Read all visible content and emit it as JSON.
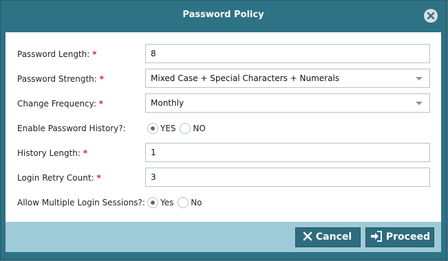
{
  "dialog": {
    "title": "Password Policy",
    "close_icon": "close-circle-icon"
  },
  "form": {
    "password_length": {
      "label": "Password Length:",
      "required": "*",
      "value": "8"
    },
    "password_strength": {
      "label": "Password Strength:",
      "required": "*",
      "value": "Mixed Case + Special Characters + Numerals"
    },
    "change_frequency": {
      "label": "Change Frequency:",
      "required": "*",
      "value": "Monthly"
    },
    "enable_history": {
      "label": "Enable Password History?:",
      "option_yes": "YES",
      "option_no": "NO",
      "selected": "YES"
    },
    "history_length": {
      "label": "History Length:",
      "required": "*",
      "value": "1"
    },
    "login_retry": {
      "label": "Login Retry Count:",
      "required": "*",
      "value": "3"
    },
    "multiple_sessions": {
      "label": "Allow Multiple Login Sessions?:",
      "option_yes": "Yes",
      "option_no": "No",
      "selected": "Yes"
    }
  },
  "footer": {
    "cancel_label": "Cancel",
    "proceed_label": "Proceed"
  },
  "colors": {
    "header": "#2e7285",
    "footer": "#9fcbd8",
    "button": "#2e6d7f",
    "required": "#d9252a"
  }
}
